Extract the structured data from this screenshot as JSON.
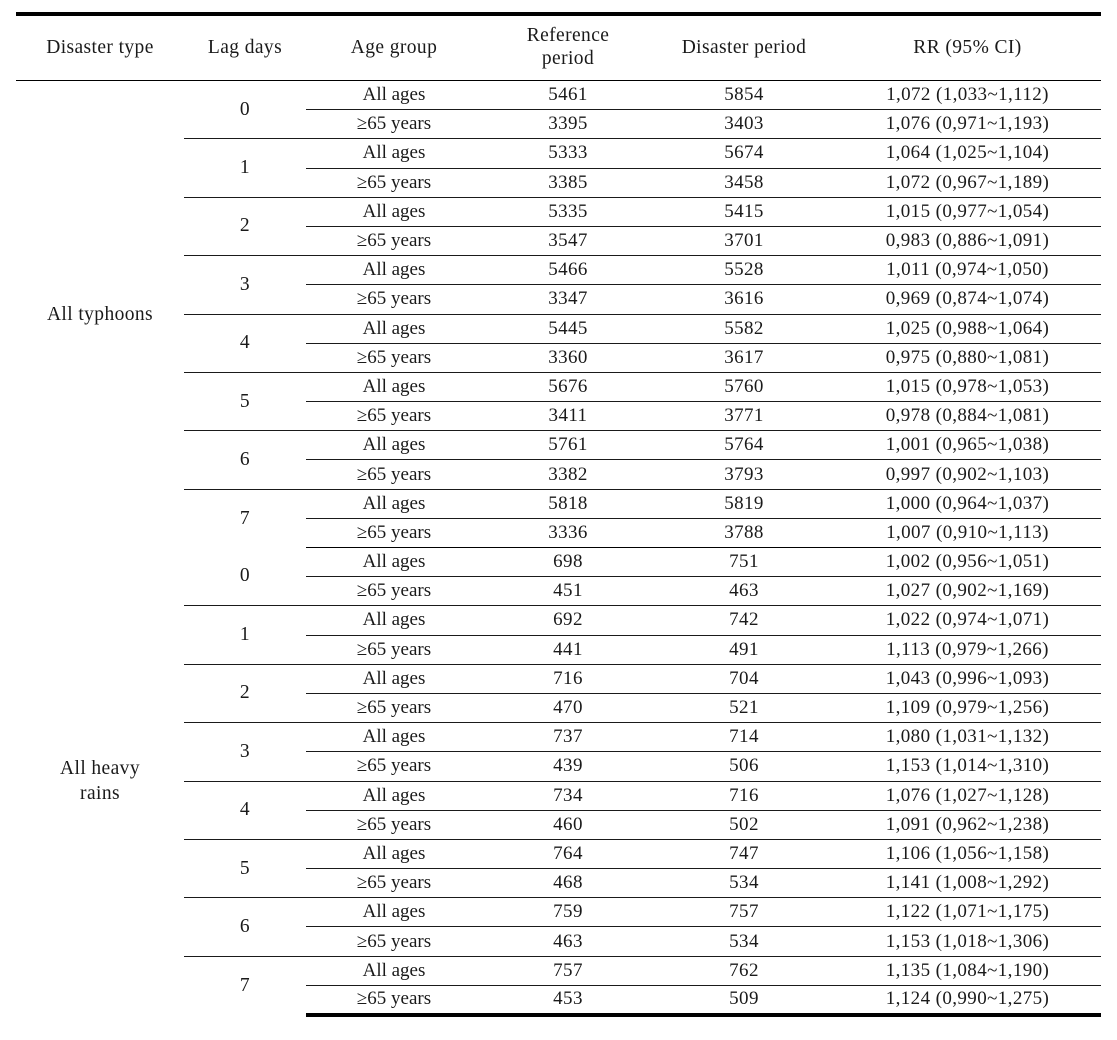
{
  "table": {
    "columns": [
      {
        "key": "disaster_type",
        "label": "Disaster type"
      },
      {
        "key": "lag_days",
        "label": "Lag days"
      },
      {
        "key": "age_group",
        "label": "Age group"
      },
      {
        "key": "reference_period",
        "label_line1": "Reference",
        "label_line2": "period"
      },
      {
        "key": "disaster_period",
        "label": "Disaster period"
      },
      {
        "key": "rr",
        "label": "RR (95% CI)"
      }
    ],
    "age_labels": {
      "all": "All ages",
      "elderly": "≥65 years"
    },
    "sections": [
      {
        "disaster_type": "All typhoons",
        "disaster_type_lines": [
          "All typhoons"
        ],
        "groups": [
          {
            "lag": "0",
            "rows": [
              {
                "age": "All ages",
                "reference": "5461",
                "disaster": "5854",
                "rr": "1,072 (1,033~1,112)"
              },
              {
                "age": "≥65 years",
                "reference": "3395",
                "disaster": "3403",
                "rr": "1,076 (0,971~1,193)"
              }
            ]
          },
          {
            "lag": "1",
            "rows": [
              {
                "age": "All ages",
                "reference": "5333",
                "disaster": "5674",
                "rr": "1,064 (1,025~1,104)"
              },
              {
                "age": "≥65 years",
                "reference": "3385",
                "disaster": "3458",
                "rr": "1,072 (0,967~1,189)"
              }
            ]
          },
          {
            "lag": "2",
            "rows": [
              {
                "age": "All ages",
                "reference": "5335",
                "disaster": "5415",
                "rr": "1,015 (0,977~1,054)"
              },
              {
                "age": "≥65 years",
                "reference": "3547",
                "disaster": "3701",
                "rr": "0,983 (0,886~1,091)"
              }
            ]
          },
          {
            "lag": "3",
            "rows": [
              {
                "age": "All ages",
                "reference": "5466",
                "disaster": "5528",
                "rr": "1,011 (0,974~1,050)"
              },
              {
                "age": "≥65 years",
                "reference": "3347",
                "disaster": "3616",
                "rr": "0,969 (0,874~1,074)"
              }
            ]
          },
          {
            "lag": "4",
            "rows": [
              {
                "age": "All ages",
                "reference": "5445",
                "disaster": "5582",
                "rr": "1,025 (0,988~1,064)"
              },
              {
                "age": "≥65 years",
                "reference": "3360",
                "disaster": "3617",
                "rr": "0,975 (0,880~1,081)"
              }
            ]
          },
          {
            "lag": "5",
            "rows": [
              {
                "age": "All ages",
                "reference": "5676",
                "disaster": "5760",
                "rr": "1,015 (0,978~1,053)"
              },
              {
                "age": "≥65 years",
                "reference": "3411",
                "disaster": "3771",
                "rr": "0,978 (0,884~1,081)"
              }
            ]
          },
          {
            "lag": "6",
            "rows": [
              {
                "age": "All ages",
                "reference": "5761",
                "disaster": "5764",
                "rr": "1,001 (0,965~1,038)"
              },
              {
                "age": "≥65 years",
                "reference": "3382",
                "disaster": "3793",
                "rr": "0,997 (0,902~1,103)"
              }
            ]
          },
          {
            "lag": "7",
            "rows": [
              {
                "age": "All ages",
                "reference": "5818",
                "disaster": "5819",
                "rr": "1,000 (0,964~1,037)"
              },
              {
                "age": "≥65 years",
                "reference": "3336",
                "disaster": "3788",
                "rr": "1,007 (0,910~1,113)"
              }
            ]
          }
        ]
      },
      {
        "disaster_type": "All heavy rains",
        "disaster_type_lines": [
          "All heavy",
          "rains"
        ],
        "groups": [
          {
            "lag": "0",
            "rows": [
              {
                "age": "All ages",
                "reference": "698",
                "disaster": "751",
                "rr": "1,002 (0,956~1,051)"
              },
              {
                "age": "≥65 years",
                "reference": "451",
                "disaster": "463",
                "rr": "1,027 (0,902~1,169)"
              }
            ]
          },
          {
            "lag": "1",
            "rows": [
              {
                "age": "All ages",
                "reference": "692",
                "disaster": "742",
                "rr": "1,022 (0,974~1,071)"
              },
              {
                "age": "≥65 years",
                "reference": "441",
                "disaster": "491",
                "rr": "1,113 (0,979~1,266)"
              }
            ]
          },
          {
            "lag": "2",
            "rows": [
              {
                "age": "All ages",
                "reference": "716",
                "disaster": "704",
                "rr": "1,043 (0,996~1,093)"
              },
              {
                "age": "≥65 years",
                "reference": "470",
                "disaster": "521",
                "rr": "1,109 (0,979~1,256)"
              }
            ]
          },
          {
            "lag": "3",
            "rows": [
              {
                "age": "All ages",
                "reference": "737",
                "disaster": "714",
                "rr": "1,080 (1,031~1,132)"
              },
              {
                "age": "≥65 years",
                "reference": "439",
                "disaster": "506",
                "rr": "1,153 (1,014~1,310)"
              }
            ]
          },
          {
            "lag": "4",
            "rows": [
              {
                "age": "All ages",
                "reference": "734",
                "disaster": "716",
                "rr": "1,076 (1,027~1,128)"
              },
              {
                "age": "≥65 years",
                "reference": "460",
                "disaster": "502",
                "rr": "1,091 (0,962~1,238)"
              }
            ]
          },
          {
            "lag": "5",
            "rows": [
              {
                "age": "All ages",
                "reference": "764",
                "disaster": "747",
                "rr": "1,106 (1,056~1,158)"
              },
              {
                "age": "≥65 years",
                "reference": "468",
                "disaster": "534",
                "rr": "1,141 (1,008~1,292)"
              }
            ]
          },
          {
            "lag": "6",
            "rows": [
              {
                "age": "All ages",
                "reference": "759",
                "disaster": "757",
                "rr": "1,122 (1,071~1,175)"
              },
              {
                "age": "≥65 years",
                "reference": "463",
                "disaster": "534",
                "rr": "1,153 (1,018~1,306)"
              }
            ]
          },
          {
            "lag": "7",
            "rows": [
              {
                "age": "All ages",
                "reference": "757",
                "disaster": "762",
                "rr": "1,135 (1,084~1,190)"
              },
              {
                "age": "≥65 years",
                "reference": "453",
                "disaster": "509",
                "rr": "1,124 (0,990~1,275)"
              }
            ]
          }
        ]
      }
    ]
  }
}
